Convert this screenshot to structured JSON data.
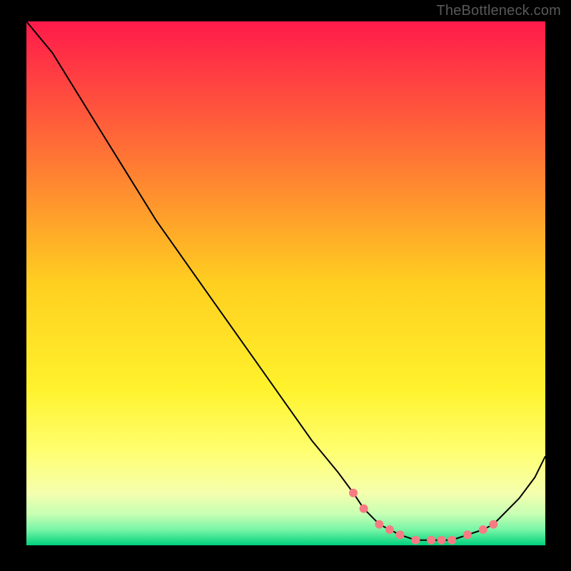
{
  "watermark": "TheBottleneck.com",
  "chart_data": {
    "type": "line",
    "title": "",
    "xlabel": "",
    "ylabel": "",
    "xlim": [
      0,
      100
    ],
    "ylim": [
      0,
      100
    ],
    "grid": false,
    "background_gradient": true,
    "gradient_colors_top_to_bottom": [
      "#ff1a4b",
      "#ffa22e",
      "#ffe824",
      "#ffff60",
      "#e5ffb8",
      "#00d27d"
    ],
    "series": [
      {
        "name": "bottleneck-curve",
        "type": "line",
        "x": [
          0,
          5,
          10,
          15,
          20,
          25,
          30,
          35,
          40,
          45,
          50,
          55,
          60,
          63,
          65,
          68,
          70,
          72,
          75,
          78,
          80,
          82,
          85,
          88,
          90,
          92,
          95,
          98,
          100
        ],
        "y": [
          100,
          94,
          86,
          78,
          70,
          62,
          55,
          48,
          41,
          34,
          27,
          20,
          14,
          10,
          7,
          4,
          3,
          2,
          1,
          1,
          1,
          1,
          2,
          3,
          4,
          6,
          9,
          13,
          17
        ]
      },
      {
        "name": "marker-dots",
        "type": "scatter",
        "color": "#f77b83",
        "x": [
          63,
          65,
          68,
          70,
          72,
          75,
          78,
          80,
          82,
          85,
          88,
          90
        ],
        "y": [
          10,
          7,
          4,
          3,
          2,
          1,
          1,
          1,
          1,
          2,
          3,
          4
        ]
      }
    ]
  }
}
